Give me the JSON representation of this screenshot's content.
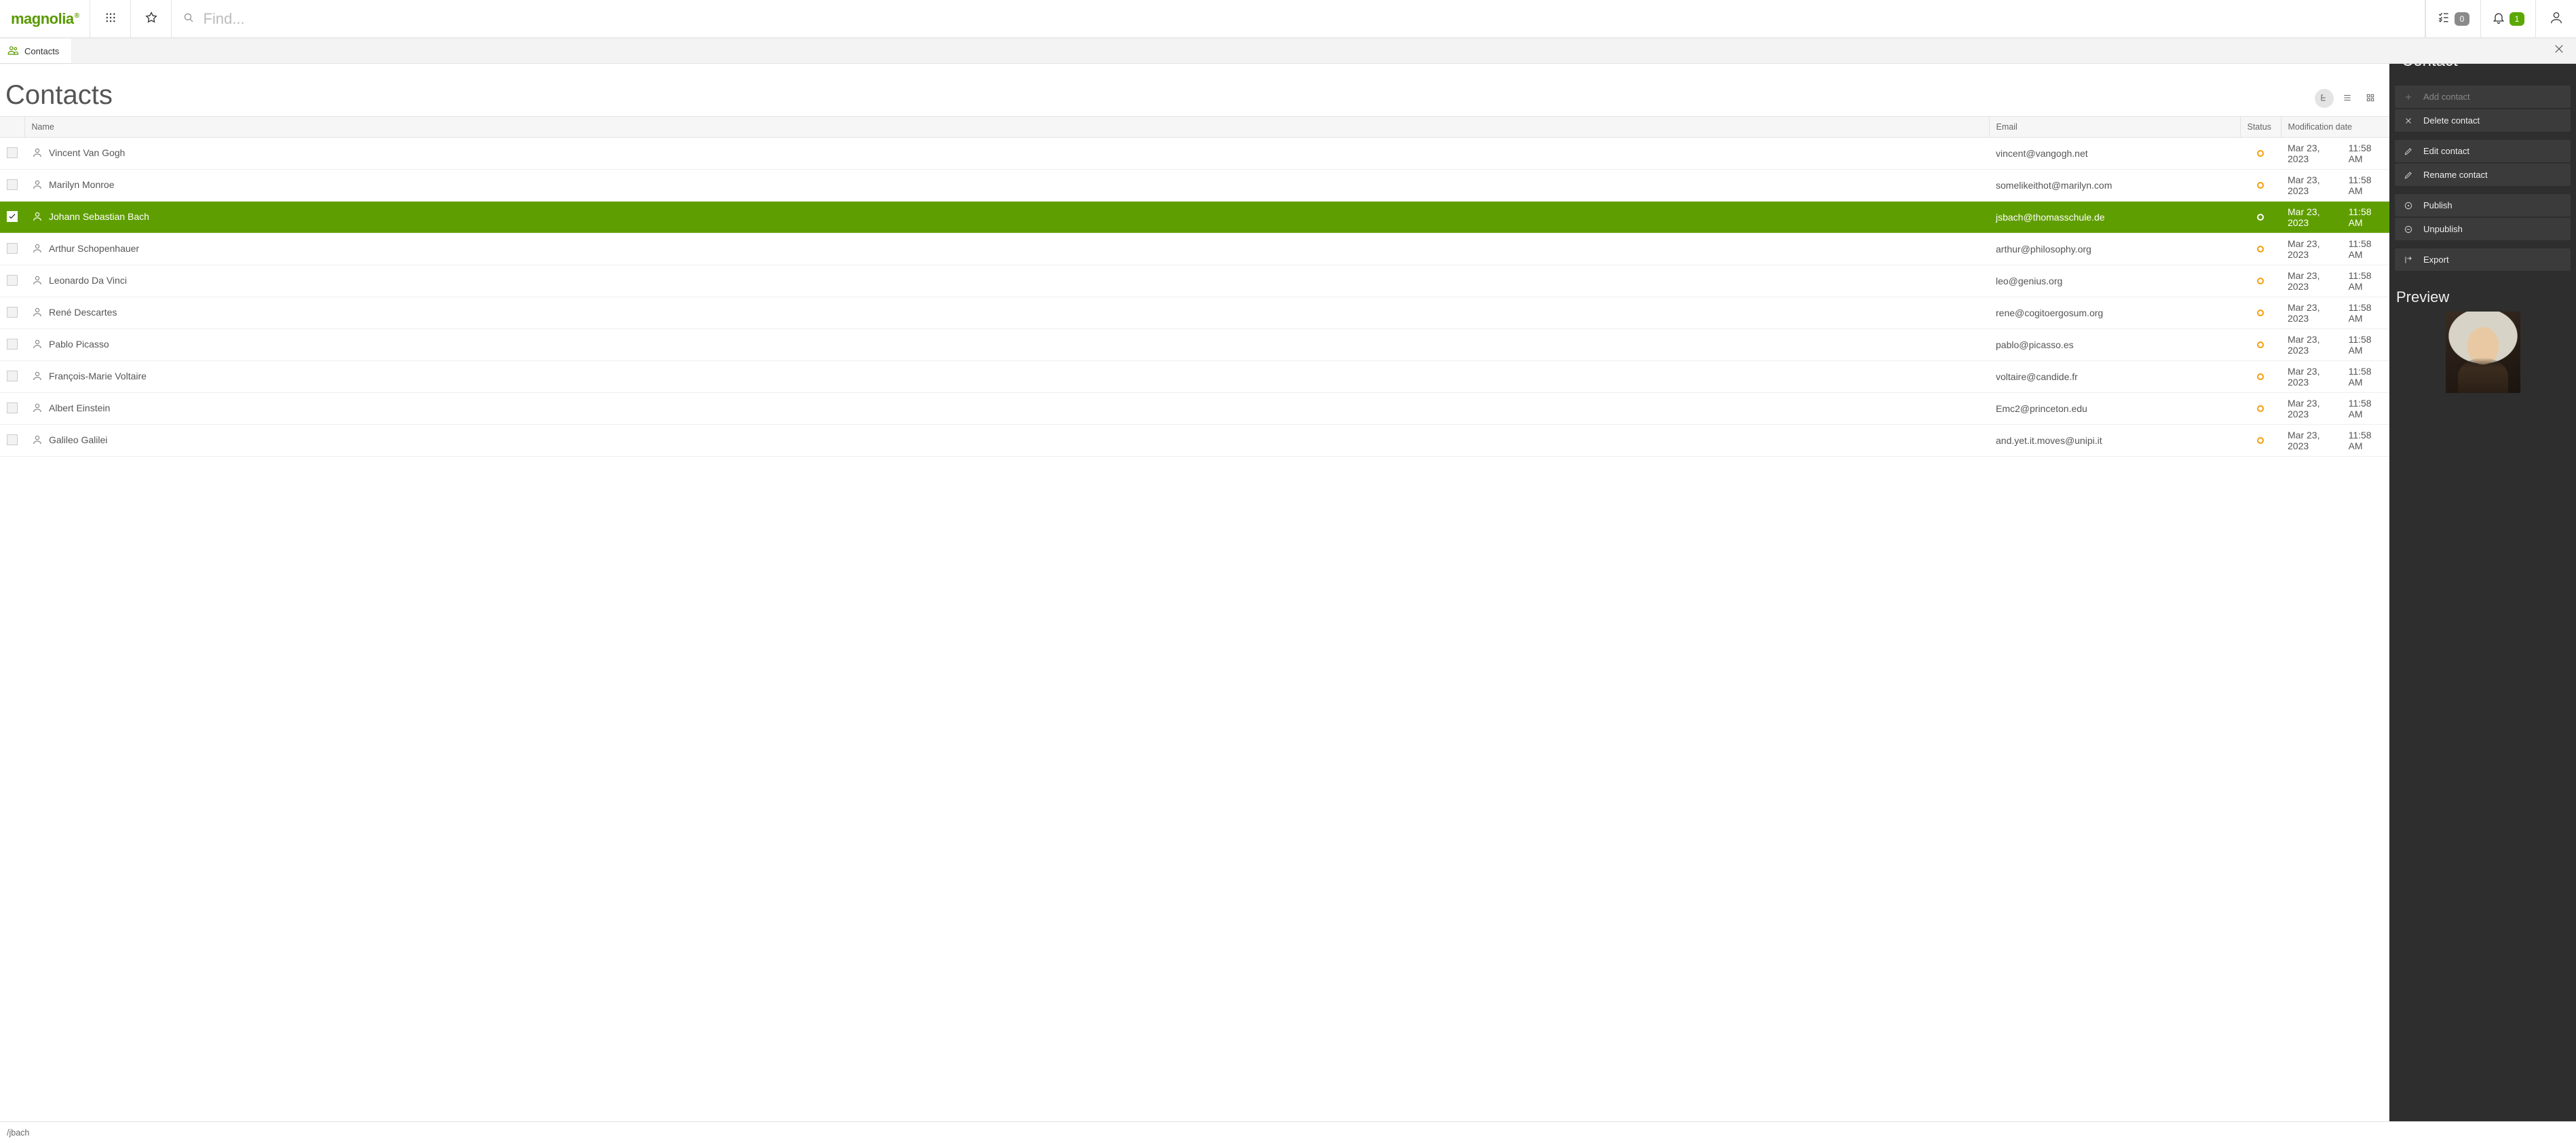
{
  "brand": "magnolia",
  "search": {
    "placeholder": "Find..."
  },
  "header": {
    "tasks_count": "0",
    "notifications_count": "1"
  },
  "tab": {
    "label": "Contacts"
  },
  "page": {
    "title": "Contacts"
  },
  "table": {
    "columns": {
      "name": "Name",
      "email": "Email",
      "status": "Status",
      "modified": "Modification date"
    },
    "rows": [
      {
        "name": "Vincent Van Gogh",
        "email": "vincent@vangogh.net",
        "date": "Mar 23, 2023",
        "time": "11:58 AM",
        "selected": false
      },
      {
        "name": "Marilyn Monroe",
        "email": "somelikeithot@marilyn.com",
        "date": "Mar 23, 2023",
        "time": "11:58 AM",
        "selected": false
      },
      {
        "name": "Johann Sebastian Bach",
        "email": "jsbach@thomasschule.de",
        "date": "Mar 23, 2023",
        "time": "11:58 AM",
        "selected": true
      },
      {
        "name": "Arthur Schopenhauer",
        "email": "arthur@philosophy.org",
        "date": "Mar 23, 2023",
        "time": "11:58 AM",
        "selected": false
      },
      {
        "name": "Leonardo Da Vinci",
        "email": "leo@genius.org",
        "date": "Mar 23, 2023",
        "time": "11:58 AM",
        "selected": false
      },
      {
        "name": "René Descartes",
        "email": "rene@cogitoergosum.org",
        "date": "Mar 23, 2023",
        "time": "11:58 AM",
        "selected": false
      },
      {
        "name": "Pablo Picasso",
        "email": "pablo@picasso.es",
        "date": "Mar 23, 2023",
        "time": "11:58 AM",
        "selected": false
      },
      {
        "name": "François-Marie Voltaire",
        "email": "voltaire@candide.fr",
        "date": "Mar 23, 2023",
        "time": "11:58 AM",
        "selected": false
      },
      {
        "name": "Albert Einstein",
        "email": "Emc2@princeton.edu",
        "date": "Mar 23, 2023",
        "time": "11:58 AM",
        "selected": false
      },
      {
        "name": "Galileo Galilei",
        "email": "and.yet.it.moves@unipi.it",
        "date": "Mar 23, 2023",
        "time": "11:58 AM",
        "selected": false
      }
    ]
  },
  "panel": {
    "title": "Contact",
    "preview_title": "Preview",
    "actions": {
      "add": {
        "label": "Add contact",
        "disabled": true
      },
      "delete": {
        "label": "Delete contact",
        "disabled": false
      },
      "edit": {
        "label": "Edit contact",
        "disabled": false
      },
      "rename": {
        "label": "Rename contact",
        "disabled": false
      },
      "publish": {
        "label": "Publish",
        "disabled": false
      },
      "unpublish": {
        "label": "Unpublish",
        "disabled": false
      },
      "export": {
        "label": "Export",
        "disabled": false
      }
    }
  },
  "footer": {
    "path": "/jbach"
  }
}
